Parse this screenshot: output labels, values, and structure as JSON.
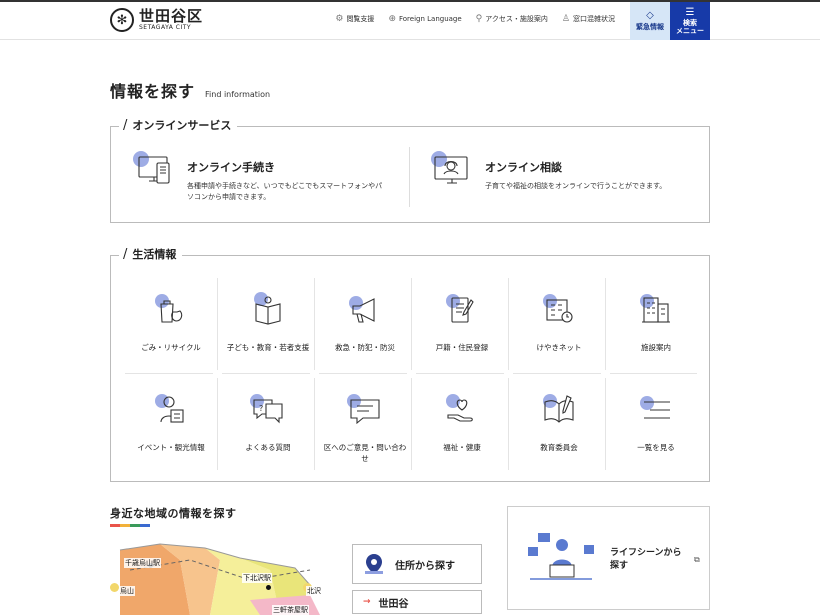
{
  "header": {
    "logo_jp": "世田谷区",
    "logo_en": "SETAGAYA CITY",
    "utils": [
      {
        "icon": "gear-icon",
        "label": "閲覧支援"
      },
      {
        "icon": "globe-icon",
        "label": "Foreign Language"
      },
      {
        "icon": "pin-icon",
        "label": "アクセス・施設案内"
      },
      {
        "icon": "crowd-icon",
        "label": "窓口混雑状況"
      }
    ],
    "emergency_label": "緊急情報",
    "search_label_1": "検索",
    "search_label_2": "メニュー"
  },
  "page": {
    "title": "情報を探す",
    "subtitle": "Find information"
  },
  "online": {
    "heading": "オンラインサービス",
    "items": [
      {
        "title": "オンライン手続き",
        "desc": "各種申請や手続きなど、いつでもどこでもスマートフォンやパソコンから申請できます。"
      },
      {
        "title": "オンライン相談",
        "desc": "子育てや福祉の相談をオンラインで行うことができます。"
      }
    ]
  },
  "life": {
    "heading": "生活情報",
    "items": [
      {
        "label": "ごみ・リサイクル",
        "icon": "garbage-bag-icon"
      },
      {
        "label": "子ども・教育・若者支援",
        "icon": "child-book-icon"
      },
      {
        "label": "救急・防犯・防災",
        "icon": "megaphone-icon"
      },
      {
        "label": "戸籍・住民登録",
        "icon": "document-pen-icon"
      },
      {
        "label": "けやきネット",
        "icon": "facility-clock-icon"
      },
      {
        "label": "施設案内",
        "icon": "building-icon"
      },
      {
        "label": "イベント・観光情報",
        "icon": "person-map-icon"
      },
      {
        "label": "よくある質問",
        "icon": "question-bubble-icon"
      },
      {
        "label": "区へのご意見・問い合わせ",
        "icon": "chat-bubble-icon"
      },
      {
        "label": "福祉・健康",
        "icon": "heart-hand-icon"
      },
      {
        "label": "教育委員会",
        "icon": "open-book-icon"
      },
      {
        "label": "一覧を見る",
        "icon": "list-icon"
      }
    ]
  },
  "area": {
    "title": "身近な地域の情報を探す",
    "map_labels": [
      "千歳烏山駅",
      "烏山",
      "下北沢駅",
      "北沢",
      "三軒茶屋駅"
    ],
    "address_button": "住所から探す",
    "district_button": "世田谷",
    "lifescene_label_1": "ライフシーンから",
    "lifescene_label_2": "探す"
  },
  "colors": {
    "accent_blue": "#173aa8",
    "icon_blob": "#8d9ee0",
    "emergency_bg": "#d6e6f7"
  }
}
